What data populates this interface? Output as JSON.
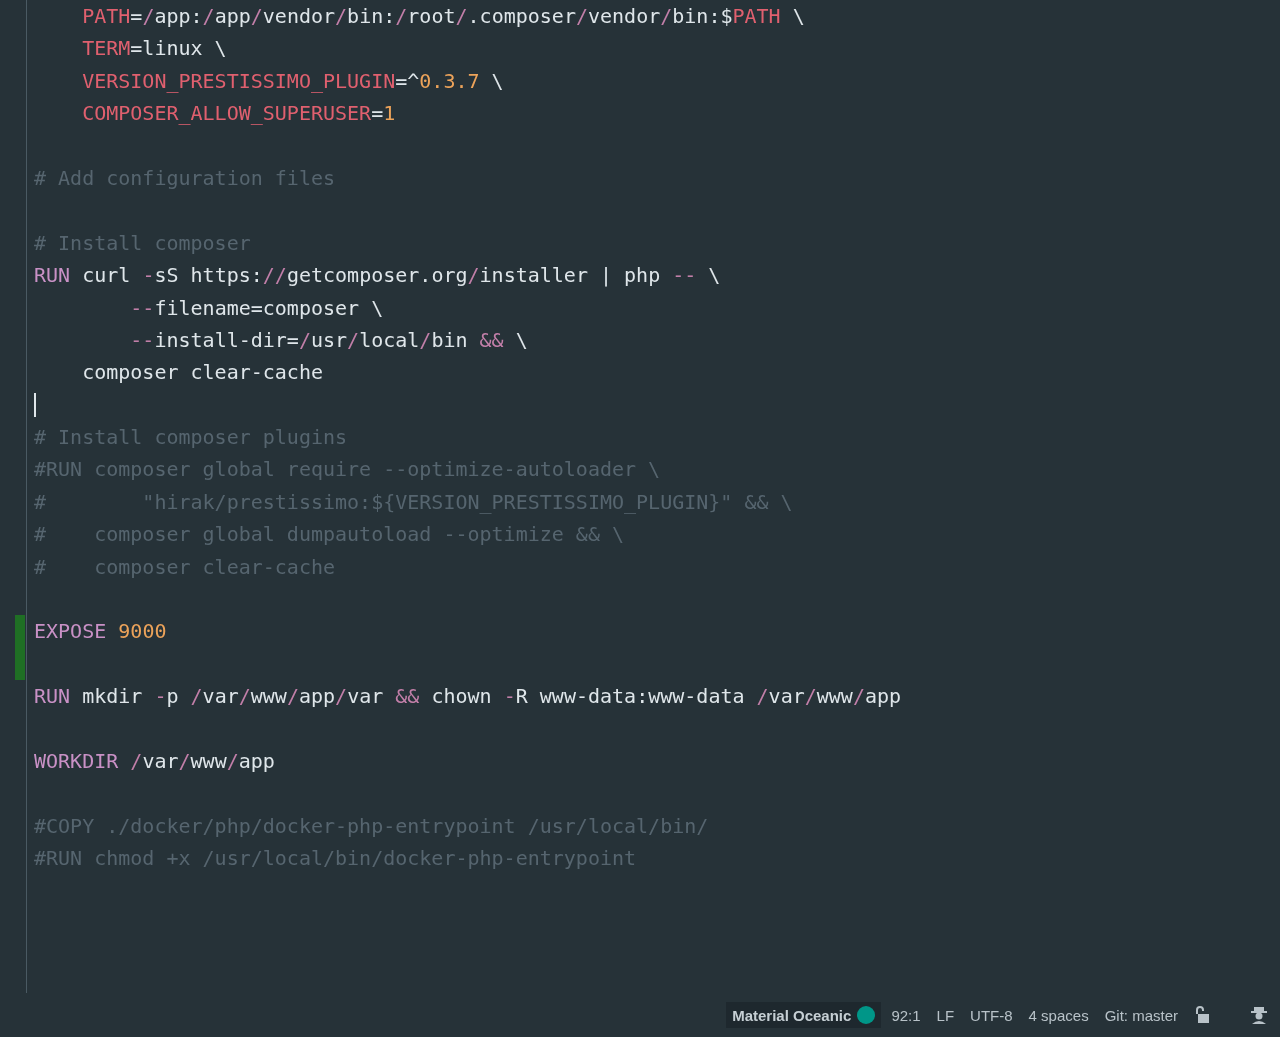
{
  "editor": {
    "lines": [
      {
        "changed": false,
        "cursor": false,
        "tokens": [
          {
            "text": "    PATH",
            "kind": "variable"
          },
          {
            "text": "=",
            "kind": "plain"
          },
          {
            "text": "/",
            "kind": "operator"
          },
          {
            "text": "app:",
            "kind": "plain"
          },
          {
            "text": "/",
            "kind": "operator"
          },
          {
            "text": "app",
            "kind": "plain"
          },
          {
            "text": "/",
            "kind": "operator"
          },
          {
            "text": "vendor",
            "kind": "plain"
          },
          {
            "text": "/",
            "kind": "operator"
          },
          {
            "text": "bin:",
            "kind": "plain"
          },
          {
            "text": "/",
            "kind": "operator"
          },
          {
            "text": "root",
            "kind": "plain"
          },
          {
            "text": "/",
            "kind": "operator"
          },
          {
            "text": ".composer",
            "kind": "plain"
          },
          {
            "text": "/",
            "kind": "operator"
          },
          {
            "text": "vendor",
            "kind": "plain"
          },
          {
            "text": "/",
            "kind": "operator"
          },
          {
            "text": "bin:$",
            "kind": "plain"
          },
          {
            "text": "PATH",
            "kind": "variable"
          },
          {
            "text": " \\",
            "kind": "plain"
          }
        ]
      },
      {
        "changed": false,
        "cursor": false,
        "tokens": [
          {
            "text": "    TERM",
            "kind": "variable"
          },
          {
            "text": "=linux \\",
            "kind": "plain"
          }
        ]
      },
      {
        "changed": false,
        "cursor": false,
        "tokens": [
          {
            "text": "    VERSION_PRESTISSIMO_PLUGIN",
            "kind": "variable"
          },
          {
            "text": "=^",
            "kind": "plain"
          },
          {
            "text": "0.3.7",
            "kind": "number"
          },
          {
            "text": " \\",
            "kind": "plain"
          }
        ]
      },
      {
        "changed": false,
        "cursor": false,
        "tokens": [
          {
            "text": "    COMPOSER_ALLOW_SUPERUSER",
            "kind": "variable"
          },
          {
            "text": "=",
            "kind": "plain"
          },
          {
            "text": "1",
            "kind": "number"
          }
        ]
      },
      {
        "changed": false,
        "cursor": false
      },
      {
        "changed": false,
        "cursor": false,
        "tokens": [
          {
            "text": "# Add configuration files",
            "kind": "comment"
          }
        ]
      },
      {
        "changed": false,
        "cursor": false
      },
      {
        "changed": false,
        "cursor": false,
        "tokens": [
          {
            "text": "# Install composer",
            "kind": "comment"
          }
        ]
      },
      {
        "changed": false,
        "cursor": false,
        "tokens": [
          {
            "text": "RUN",
            "kind": "keyword"
          },
          {
            "text": " curl ",
            "kind": "plain"
          },
          {
            "text": "-",
            "kind": "operator"
          },
          {
            "text": "sS https:",
            "kind": "plain"
          },
          {
            "text": "//",
            "kind": "operator"
          },
          {
            "text": "getcomposer.org",
            "kind": "plain"
          },
          {
            "text": "/",
            "kind": "operator"
          },
          {
            "text": "installer | php ",
            "kind": "plain"
          },
          {
            "text": "--",
            "kind": "operator"
          },
          {
            "text": " \\",
            "kind": "plain"
          }
        ]
      },
      {
        "changed": false,
        "cursor": false,
        "tokens": [
          {
            "text": "        --",
            "kind": "operator"
          },
          {
            "text": "filename=composer \\",
            "kind": "plain"
          }
        ]
      },
      {
        "changed": false,
        "cursor": false,
        "tokens": [
          {
            "text": "        --",
            "kind": "operator"
          },
          {
            "text": "install-dir=",
            "kind": "plain"
          },
          {
            "text": "/",
            "kind": "operator"
          },
          {
            "text": "usr",
            "kind": "plain"
          },
          {
            "text": "/",
            "kind": "operator"
          },
          {
            "text": "local",
            "kind": "plain"
          },
          {
            "text": "/",
            "kind": "operator"
          },
          {
            "text": "bin ",
            "kind": "plain"
          },
          {
            "text": "&&",
            "kind": "operator"
          },
          {
            "text": " \\",
            "kind": "plain"
          }
        ]
      },
      {
        "changed": false,
        "cursor": false,
        "tokens": [
          {
            "text": "    composer clear-cache",
            "kind": "plain"
          }
        ]
      },
      {
        "changed": false,
        "cursor": true
      },
      {
        "changed": false,
        "cursor": false,
        "tokens": [
          {
            "text": "# Install composer plugins",
            "kind": "comment"
          }
        ]
      },
      {
        "changed": false,
        "cursor": false,
        "tokens": [
          {
            "text": "#RUN composer global require --optimize-autoloader \\",
            "kind": "comment"
          }
        ]
      },
      {
        "changed": false,
        "cursor": false,
        "tokens": [
          {
            "text": "#        \"hirak/prestissimo:${VERSION_PRESTISSIMO_PLUGIN}\" && \\",
            "kind": "comment"
          }
        ]
      },
      {
        "changed": false,
        "cursor": false,
        "tokens": [
          {
            "text": "#    composer global dumpautoload --optimize && \\",
            "kind": "comment"
          }
        ]
      },
      {
        "changed": false,
        "cursor": false,
        "tokens": [
          {
            "text": "#    composer clear-cache",
            "kind": "comment"
          }
        ]
      },
      {
        "changed": false,
        "cursor": false
      },
      {
        "changed": true,
        "cursor": false,
        "tokens": [
          {
            "text": "EXPOSE ",
            "kind": "keyword"
          },
          {
            "text": "9000",
            "kind": "number"
          }
        ]
      },
      {
        "changed": true,
        "cursor": false
      },
      {
        "changed": false,
        "cursor": false,
        "tokens": [
          {
            "text": "RUN",
            "kind": "keyword"
          },
          {
            "text": " mkdir ",
            "kind": "plain"
          },
          {
            "text": "-",
            "kind": "operator"
          },
          {
            "text": "p ",
            "kind": "plain"
          },
          {
            "text": "/",
            "kind": "operator"
          },
          {
            "text": "var",
            "kind": "plain"
          },
          {
            "text": "/",
            "kind": "operator"
          },
          {
            "text": "www",
            "kind": "plain"
          },
          {
            "text": "/",
            "kind": "operator"
          },
          {
            "text": "app",
            "kind": "plain"
          },
          {
            "text": "/",
            "kind": "operator"
          },
          {
            "text": "var ",
            "kind": "plain"
          },
          {
            "text": "&&",
            "kind": "operator"
          },
          {
            "text": " chown ",
            "kind": "plain"
          },
          {
            "text": "-",
            "kind": "operator"
          },
          {
            "text": "R www-data:www-data ",
            "kind": "plain"
          },
          {
            "text": "/",
            "kind": "operator"
          },
          {
            "text": "var",
            "kind": "plain"
          },
          {
            "text": "/",
            "kind": "operator"
          },
          {
            "text": "www",
            "kind": "plain"
          },
          {
            "text": "/",
            "kind": "operator"
          },
          {
            "text": "app",
            "kind": "plain"
          }
        ]
      },
      {
        "changed": false,
        "cursor": false
      },
      {
        "changed": false,
        "cursor": false,
        "tokens": [
          {
            "text": "WORKDIR ",
            "kind": "keyword"
          },
          {
            "text": "/",
            "kind": "operator"
          },
          {
            "text": "var",
            "kind": "plain"
          },
          {
            "text": "/",
            "kind": "operator"
          },
          {
            "text": "www",
            "kind": "plain"
          },
          {
            "text": "/",
            "kind": "operator"
          },
          {
            "text": "app",
            "kind": "plain"
          }
        ]
      },
      {
        "changed": false,
        "cursor": false
      },
      {
        "changed": false,
        "cursor": false,
        "tokens": [
          {
            "text": "#COPY ./docker/php/docker-php-entrypoint /usr/local/bin/",
            "kind": "comment"
          }
        ]
      },
      {
        "changed": false,
        "cursor": false,
        "tokens": [
          {
            "text": "#RUN chmod +x /usr/local/bin/docker-php-entrypoint",
            "kind": "comment"
          }
        ]
      }
    ]
  },
  "status_bar": {
    "theme": {
      "label": "Material Oceanic",
      "color": "#009688"
    },
    "items": [
      "92:1",
      "LF",
      "UTF-8",
      "4 spaces",
      "Git: master"
    ],
    "locked": false
  }
}
